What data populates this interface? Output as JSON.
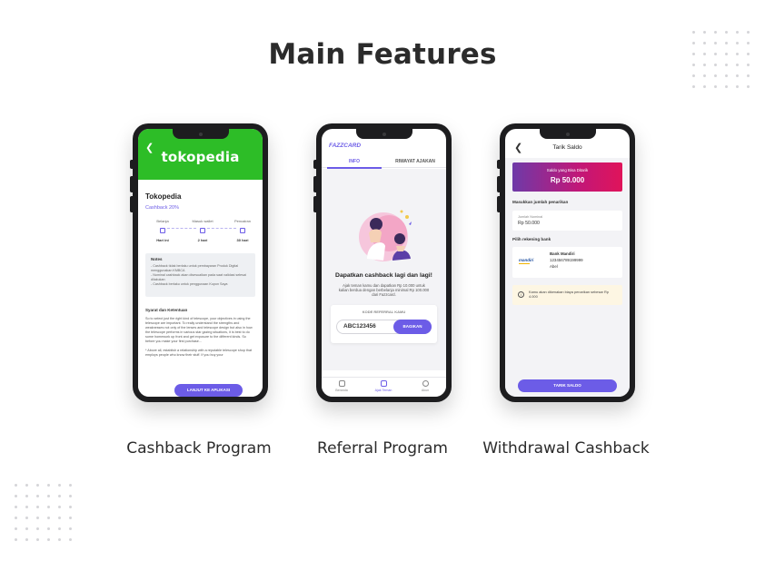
{
  "page": {
    "title": "Main Features"
  },
  "colors": {
    "accent": "#6c5ce7",
    "tokopedia_green": "#2dbd27",
    "balance_gradient_start": "#6e3aa8",
    "balance_gradient_end": "#e0145a"
  },
  "features": [
    {
      "caption": "Cashback Program"
    },
    {
      "caption": "Referral Program"
    },
    {
      "caption": "Withdrawal Cashback"
    }
  ],
  "cashback_screen": {
    "back_icon": "chevron-left-icon",
    "brand": "tokopedia",
    "merchant_name": "Tokopedia",
    "cashback_label": "Cashback 20%",
    "steps": [
      {
        "label": "Belanja",
        "value": "Hari ini",
        "icon": "cart-icon"
      },
      {
        "label": "Masuk wallet",
        "value": "2 hari",
        "icon": "wallet-icon"
      },
      {
        "label": "Pencairan",
        "value": "30 hari",
        "icon": "cashout-icon"
      }
    ],
    "notes_title": "Notes",
    "notes": [
      "- Cashback tidak berlaku untuk pembayaran Produk Digital menggunakan KMBCA",
      "- Nominal cashback akan disesuaikan pada saat validasi selesai dilakukan",
      "- Cashback berlaku untuk penggunaan Kupon Saya"
    ],
    "terms_title": "Syarat dan Ketentuan",
    "terms_body": "So to select just the right kind of telescope, your objectives in using the telescope are important. To really understand the strengths and weaknesses not only of the lenses and telescope design but also in how the telescope performs in various star gazing situations, it is best to do some homework up front and get exposure to the different kinds. So before you make your first purchase...",
    "terms_body_2": "*     Above all, establish a relationship with a reputable telescope shop that employs people who know their stuff. If you buy your",
    "cta_label": "LANJUT KE APLIKASI"
  },
  "referral_screen": {
    "brand": "FAZZCARD",
    "tabs": [
      {
        "label": "INFO"
      },
      {
        "label": "RIWAYAT AJAKAN"
      }
    ],
    "heading": "Dapatkan cashback lagi dan lagi!",
    "description": "Ajak teman kamu dan dapatkan Rp 10.000 untuk kalian berdua dengan berbelanja minimal Rp 100.000 dari Fazzcard.",
    "code_label": "KODE REFERRAL KAMU",
    "code_value": "ABC123456",
    "share_label": "BAGIKAN",
    "nav": [
      {
        "label": "Beranda",
        "icon": "home-icon"
      },
      {
        "label": "Ajak Teman",
        "icon": "friends-icon"
      },
      {
        "label": "Akun",
        "icon": "user-icon"
      }
    ]
  },
  "withdraw_screen": {
    "back_icon": "chevron-left-icon",
    "title": "Tarik Saldo",
    "balance_label": "Saldo yang Bisa Ditarik",
    "balance_value": "Rp 50.000",
    "amount_section": "Masukkan jumlah penarikan",
    "amount_field_label": "Jumlah Nominal",
    "amount_field_value": "Rp 50.000",
    "bank_section": "Pilih rekening bank",
    "bank_logo": "mandiri",
    "bank_name": "Bank Mandiri",
    "bank_account": "123456789199999",
    "bank_holder": "Abel",
    "info_text": "Kamu akan dikenakan biaya penarikan sebesar Rp 4.000",
    "button_label": "TARIK SALDO"
  }
}
